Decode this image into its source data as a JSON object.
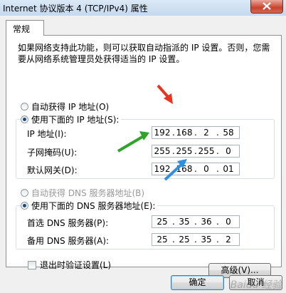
{
  "window": {
    "title": "Internet 协议版本 4 (TCP/IPv4) 属性"
  },
  "tab": {
    "label": "常规"
  },
  "description": "如果网络支持此功能，则可以获取自动指派的 IP 设置。否则，您需要从网络系统管理员处获得适当的 IP 设置。",
  "ip_section": {
    "auto_label": "自动获得 IP 地址(O)",
    "manual_label": "使用下面的 IP 地址(S):",
    "auto_selected": false,
    "fields": [
      {
        "label": "IP 地址(I):",
        "octets": [
          "192",
          "168",
          "2",
          "58"
        ]
      },
      {
        "label": "子网掩码(U):",
        "octets": [
          "255",
          "255",
          "255",
          "0"
        ]
      },
      {
        "label": "默认网关(D):",
        "octets": [
          "192",
          "168",
          "0",
          "01"
        ]
      }
    ]
  },
  "dns_section": {
    "auto_label": "自动获得 DNS 服务器地址(B)",
    "manual_label": "使用下面的 DNS 服务器地址(E):",
    "auto_selected": false,
    "fields": [
      {
        "label": "首选 DNS 服务器(P):",
        "octets": [
          "25",
          "35",
          "36",
          "0"
        ]
      },
      {
        "label": "备用 DNS 服务器(A):",
        "octets": [
          "25",
          "25",
          "35",
          "2"
        ]
      }
    ]
  },
  "validate_label": "退出时验证设置(L)",
  "validate_checked": false,
  "buttons": {
    "advanced": "高级(V)...",
    "ok": "确定",
    "cancel": "取消"
  },
  "watermark": "Baidu 经验",
  "colors": {
    "arrow_red": "#e8331f",
    "arrow_green": "#2ea42a",
    "arrow_blue": "#2f8fe0"
  }
}
